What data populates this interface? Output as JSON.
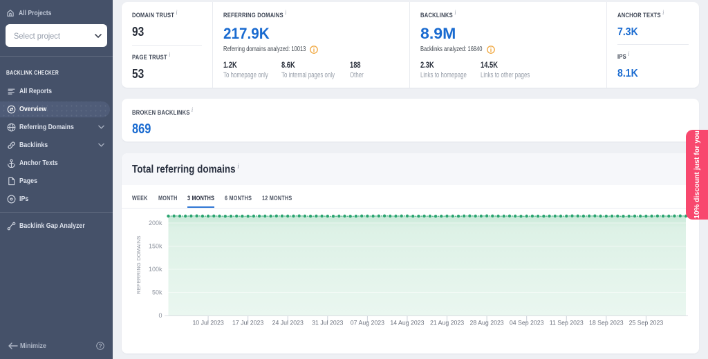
{
  "sidebar": {
    "all_projects_label": "All Projects",
    "select_project_placeholder": "Select project",
    "section_label": "BACKLINK CHECKER",
    "items": [
      {
        "id": "all-reports",
        "label": "All Reports",
        "icon": "reports-icon",
        "active": false,
        "chevron": false
      },
      {
        "id": "overview",
        "label": "Overview",
        "icon": "compass-icon",
        "active": true,
        "chevron": false
      },
      {
        "id": "referring-domains",
        "label": "Referring Domains",
        "icon": "globe-icon",
        "active": false,
        "chevron": true
      },
      {
        "id": "backlinks",
        "label": "Backlinks",
        "icon": "link-icon",
        "active": false,
        "chevron": true
      },
      {
        "id": "anchor-texts",
        "label": "Anchor Texts",
        "icon": "anchor-icon",
        "active": false,
        "chevron": false
      },
      {
        "id": "pages",
        "label": "Pages",
        "icon": "page-icon",
        "active": false,
        "chevron": false
      },
      {
        "id": "ips",
        "label": "IPs",
        "icon": "target-icon",
        "active": false,
        "chevron": false
      },
      {
        "id": "divider"
      },
      {
        "id": "backlink-gap-analyzer",
        "label": "Backlink Gap Analyzer",
        "icon": "gap-icon",
        "active": false,
        "chevron": false
      }
    ],
    "minimize_label": "Minimize"
  },
  "summary": {
    "domain_trust": {
      "label": "DOMAIN TRUST",
      "value": "93"
    },
    "page_trust": {
      "label": "PAGE TRUST",
      "value": "53"
    },
    "referring_domains": {
      "label": "REFERRING DOMAINS",
      "value": "217.9K",
      "analyzed": "Referring domains analyzed: 10013",
      "stats": [
        {
          "value": "1.2K",
          "label": "To homepage only"
        },
        {
          "value": "8.6K",
          "label": "To internal pages only"
        },
        {
          "value": "188",
          "label": "Other"
        }
      ]
    },
    "backlinks": {
      "label": "BACKLINKS",
      "value": "8.9M",
      "analyzed": "Backlinks analyzed: 16840",
      "stats": [
        {
          "value": "2.3K",
          "label": "Links to homepage"
        },
        {
          "value": "14.5K",
          "label": "Links to other pages"
        }
      ]
    },
    "anchor_texts": {
      "label": "ANCHOR TEXTS",
      "value": "7.3K"
    },
    "ips": {
      "label": "IPS",
      "value": "8.1K"
    }
  },
  "broken_backlinks": {
    "label": "BROKEN BACKLINKS",
    "value": "869"
  },
  "chart_card": {
    "title": "Total referring domains",
    "tabs": [
      "WEEK",
      "MONTH",
      "3 MONTHS",
      "6 MONTHS",
      "12 MONTHS"
    ],
    "active_tab": "3 MONTHS"
  },
  "chart_data": {
    "type": "area",
    "title": "Total referring domains",
    "ylabel": "REFERRING DOMAINS",
    "ylim": [
      0,
      225000
    ],
    "y_ticks": [
      0,
      50000,
      100000,
      150000,
      200000
    ],
    "y_tick_labels": [
      "0",
      "50k",
      "100k",
      "150k",
      "200k"
    ],
    "x_labels": [
      "10 Jul 2023",
      "17 Jul 2023",
      "24 Jul 2023",
      "31 Jul 2023",
      "07 Aug 2023",
      "14 Aug 2023",
      "21 Aug 2023",
      "28 Aug 2023",
      "04 Sep 2023",
      "11 Sep 2023",
      "18 Sep 2023",
      "25 Sep 2023"
    ],
    "x_label_first_index": 7,
    "x_label_step": 7,
    "num_points": 92,
    "series": [
      {
        "name": "Total referring domains",
        "base_value": 215000,
        "values": [
          215000,
          215286,
          215061,
          214948,
          215285,
          215348,
          214982,
          214953,
          215225,
          215056,
          214691,
          214826,
          215056,
          214801,
          214625,
          214964,
          215136,
          214869,
          214901,
          215293,
          215276,
          214970,
          215102,
          215360,
          215100,
          214806,
          215015,
          215118,
          214756,
          214646,
          214977,
          214990,
          214695,
          214841,
          215216,
          215108,
          214895,
          215173,
          215395,
          215095,
          214936,
          215214,
          215199,
          214797,
          214779,
          215059,
          214906,
          214606,
          214827,
          215109,
          214900,
          214789,
          215162,
          215311,
          215014,
          215022,
          215351,
          215243,
          214878,
          214977,
          215188,
          214898,
          214636,
          214894,
          215032,
          214729,
          214710,
          215103,
          215139,
          214871,
          215038,
          215377,
          215202,
          214942,
          215167,
          215305,
          214940,
          214768,
          215040,
          215017,
          214652,
          214713,
          215053,
          214947,
          214720,
          215003,
          215292,
          215068,
          214950,
          215283,
          215348,
          214980
        ]
      }
    ],
    "legend": null,
    "grid": false,
    "line_style": "dotted",
    "marker_color": "#2aa470",
    "fill_top_color": "#c9e9d8",
    "fill_mid_color": "#ddf1e6",
    "fill_bottom_color": "#eaf7f0"
  },
  "ribbon": {
    "text": "10% discount just for you",
    "color": "#f8486e"
  },
  "icons": {
    "home": "home-icon",
    "chevron_down": "chevron-down-icon",
    "info": "info-icon",
    "question": "question-circle-icon",
    "arrow_left": "arrow-left-icon"
  }
}
